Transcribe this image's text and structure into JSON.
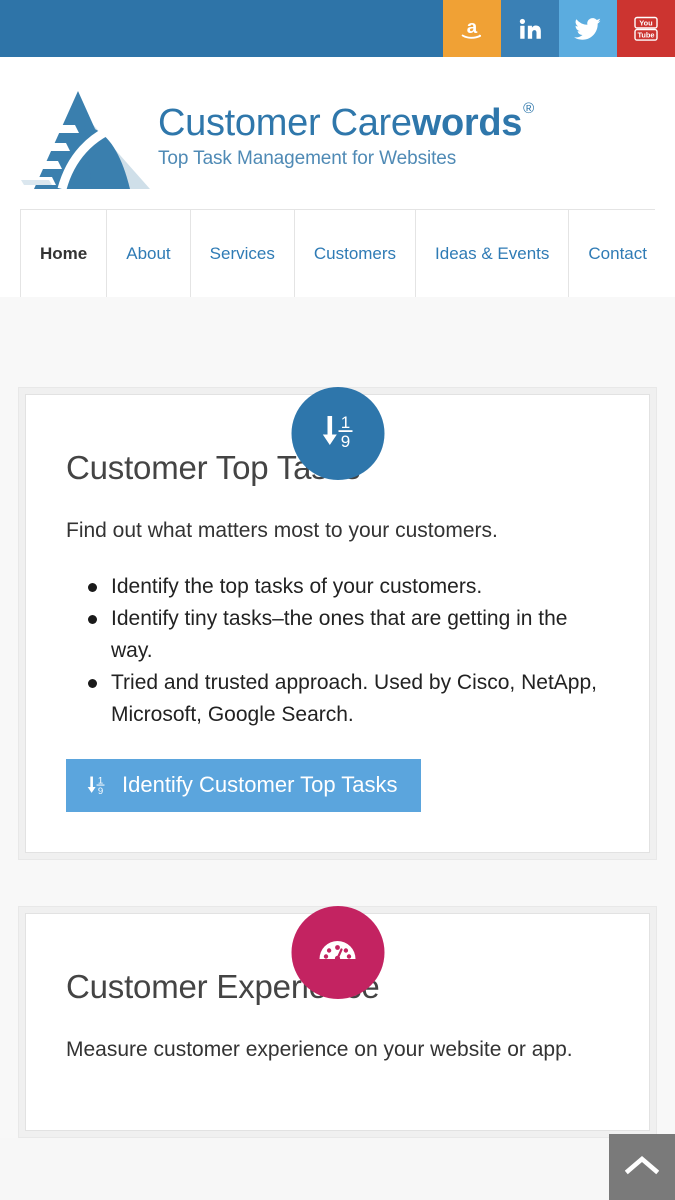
{
  "topbar": {
    "background": "#2e74a8",
    "social": [
      {
        "name": "amazon-icon",
        "label": "Amazon",
        "color": "#f0a135"
      },
      {
        "name": "linkedin-icon",
        "label": "LinkedIn",
        "color": "#3a80b5"
      },
      {
        "name": "twitter-icon",
        "label": "Twitter",
        "color": "#5bacdf"
      },
      {
        "name": "youtube-icon",
        "label": "YouTube",
        "color": "#cc3430"
      }
    ]
  },
  "logo": {
    "title_light": "Customer Care",
    "title_bold": "words",
    "registered": "®",
    "tagline": "Top Task Management for Websites",
    "color": "#2f77ab"
  },
  "nav": {
    "items": [
      {
        "label": "Home",
        "active": true
      },
      {
        "label": "About",
        "active": false
      },
      {
        "label": "Services",
        "active": false
      },
      {
        "label": "Customers",
        "active": false
      },
      {
        "label": "Ideas & Events",
        "active": false
      },
      {
        "label": "Contact",
        "active": false
      }
    ]
  },
  "sections": [
    {
      "badge_icon": "sort-numeric-down-icon",
      "badge_color": "#2e76ab",
      "title": "Customer Top Tasks",
      "lede": "Find out what matters most to your customers.",
      "bullets": [
        "Identify the top tasks of your customers.",
        "Identify tiny tasks–the ones that are getting in the way.",
        "Tried and trusted approach. Used by Cisco, NetApp, Microsoft, Google Search."
      ],
      "cta": {
        "label": "Identify Customer Top Tasks",
        "icon": "sort-numeric-down-icon",
        "color": "#5ba5dd"
      }
    },
    {
      "badge_icon": "tachometer-icon",
      "badge_color": "#c32361",
      "title": "Customer Experience",
      "lede": "Measure customer experience on your website or app.",
      "bullets": [],
      "cta": null
    }
  ],
  "scroll_top": {
    "icon": "chevron-up-icon",
    "label": "Back to top",
    "color": "#7a7a7a"
  }
}
